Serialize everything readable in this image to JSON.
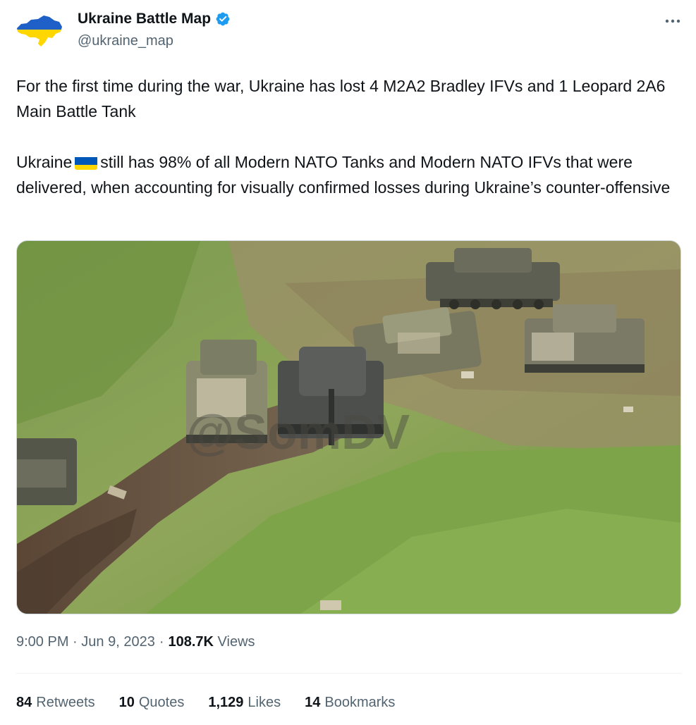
{
  "author": {
    "display_name": "Ukraine Battle Map",
    "handle": "@ukraine_map",
    "avatar_icon": "ukraine-map-flag-icon",
    "verified": true
  },
  "tweet": {
    "paragraph1": "For the first time during the war, Ukraine has lost 4 M2A2 Bradley IFVs and 1 Leopard 2A6 Main Battle Tank",
    "paragraph2_before_flag": "Ukraine",
    "paragraph2_after_flag": "still has 98% of all Modern NATO Tanks and Modern NATO IFVs that were delivered, when accounting for visually confirmed losses during Ukraine’s counter-offensive",
    "flag_icon": "ukraine-flag-icon",
    "media_watermark": "@SomDV"
  },
  "meta": {
    "time": "9:00 PM",
    "separator": "·",
    "date": "Jun 9, 2023",
    "views_count": "108.7K",
    "views_label": "Views"
  },
  "stats": {
    "retweets": {
      "count": "84",
      "label": "Retweets"
    },
    "quotes": {
      "count": "10",
      "label": "Quotes"
    },
    "likes": {
      "count": "1,129",
      "label": "Likes"
    },
    "bookmarks": {
      "count": "14",
      "label": "Bookmarks"
    }
  },
  "colors": {
    "text": "#0f1419",
    "secondary": "#536471",
    "verified": "#1d9bf0",
    "flag_blue": "#0057b7",
    "flag_yellow": "#ffd700"
  }
}
